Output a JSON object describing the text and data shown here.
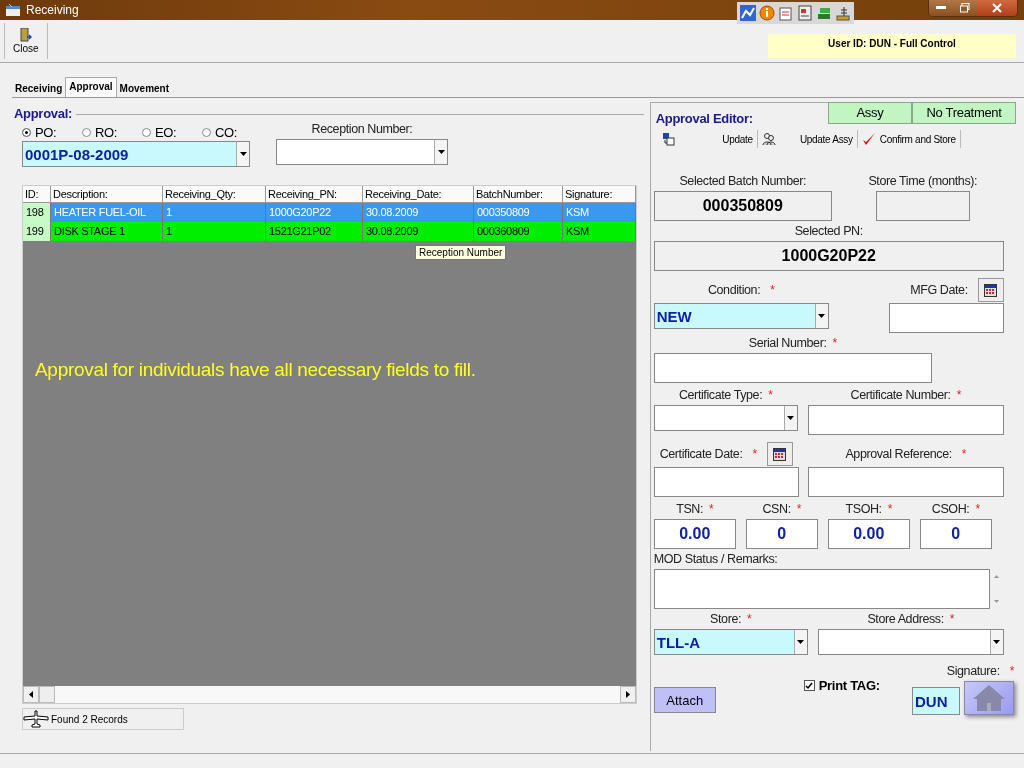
{
  "window": {
    "title": "Receiving"
  },
  "toolbar": {
    "buttons": [
      {
        "label": "Close"
      }
    ],
    "user_info": "User ID: DUN - Full Control"
  },
  "tabs": [
    {
      "label": "Receiving",
      "selected": false
    },
    {
      "label": "Approval",
      "selected": true
    },
    {
      "label": "Movement",
      "selected": false
    }
  ],
  "approval": {
    "title": "Approval:",
    "order_types": [
      {
        "label": "PO:",
        "selected": true
      },
      {
        "label": "RO:",
        "selected": false
      },
      {
        "label": "EO:",
        "selected": false
      },
      {
        "label": "CO:",
        "selected": false
      }
    ],
    "order_number": "0001P-08-2009",
    "reception_label": "Reception Number:",
    "table": {
      "columns": [
        "ID:",
        "Description:",
        "Receiving_Qty:",
        "Receiving_PN:",
        "Receiving_Date:",
        "BatchNumber:",
        "Signature:"
      ],
      "rows": [
        {
          "selected": true,
          "cells": [
            "198",
            "HEATER FUEL-OIL",
            "1",
            "1000G20P22",
            "30.08.2009",
            "000350809",
            "KSM"
          ]
        },
        {
          "selected": false,
          "cells": [
            "199",
            "DISK STAGE 1",
            "1",
            "1521G21P02",
            "30.08.2009",
            "000360809",
            "KSM"
          ]
        }
      ]
    },
    "tooltip": "Reception Number",
    "message": "Approval for individuals have all necessary fields to fill.",
    "status": "Found 2 Records"
  },
  "editor": {
    "title": "Approval Editor:",
    "tags": [
      "Assy",
      "No Treatment"
    ],
    "actions": [
      {
        "label": "Update",
        "kind": "copy"
      },
      {
        "label": "Update Assy",
        "kind": "people"
      },
      {
        "label": "Confirm and Store",
        "kind": "check"
      }
    ],
    "batch": {
      "label": "Selected Batch Number:",
      "value": "000350809"
    },
    "store_time": {
      "label": "Store Time (months):"
    },
    "pn": {
      "label": "Selected PN:",
      "value": "1000G20P22"
    },
    "condition": {
      "label": "Condition:",
      "required_mark": "*",
      "value": "NEW"
    },
    "mfg_date": {
      "label": "MFG Date:"
    },
    "serial_number": {
      "label": "Serial Number:",
      "required_mark": "*"
    },
    "certificate_type": {
      "label": "Certificate Type:",
      "required_mark": "*"
    },
    "certificate_number": {
      "label": "Certificate Number:",
      "required_mark": "*"
    },
    "certificate_date": {
      "label": "Certificate Date:",
      "required_mark": "*"
    },
    "approval_reference": {
      "label": "Approval Reference:",
      "required_mark": "*"
    },
    "counters": [
      {
        "label": "TSN:",
        "required_mark": "*",
        "value": "0.00"
      },
      {
        "label": "CSN:",
        "required_mark": "*",
        "value": "0"
      },
      {
        "label": "TSOH:",
        "required_mark": "*",
        "value": "0.00"
      },
      {
        "label": "CSOH:",
        "required_mark": "*",
        "value": "0"
      }
    ],
    "remarks": {
      "label": "MOD Status / Remarks:"
    },
    "store": {
      "label": "Store:",
      "required_mark": "*",
      "value": "TLL-A"
    },
    "store_address": {
      "label": "Store Address:",
      "required_mark": "*"
    },
    "signature": {
      "label": "Signature:",
      "required_mark": "*",
      "value": "DUN"
    },
    "print_tag": {
      "label": "Print TAG:",
      "checked": true
    },
    "attach": "Attach"
  }
}
